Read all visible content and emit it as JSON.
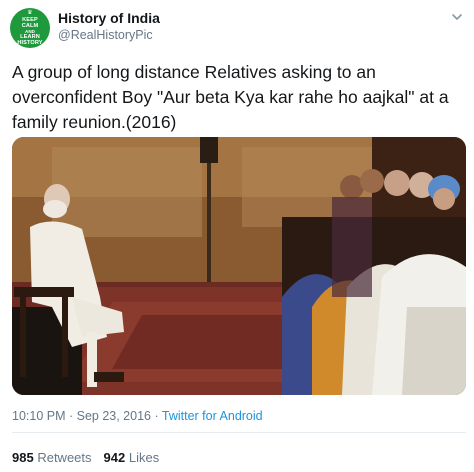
{
  "header": {
    "avatar_text": [
      "KEEP",
      "CALM",
      "AND",
      "LEARN",
      "HISTORY"
    ],
    "display_name": "History of India",
    "handle": "@RealHistoryPic"
  },
  "tweet": {
    "text": "A group of long distance Relatives asking to an overconfident Boy \"Aur beta Kya kar rahe ho aajkal\" at a family reunion.(2016)"
  },
  "meta": {
    "timestamp": "10:10 PM · Sep 23, 2016 · ",
    "source": "Twitter for Android"
  },
  "stats": {
    "retweets_count": "985",
    "retweets_label": "Retweets",
    "likes_count": "942",
    "likes_label": "Likes"
  },
  "colors": {
    "avatar": "#1e9a3c",
    "link": "#1b95e0",
    "secondary_text": "#657786"
  }
}
